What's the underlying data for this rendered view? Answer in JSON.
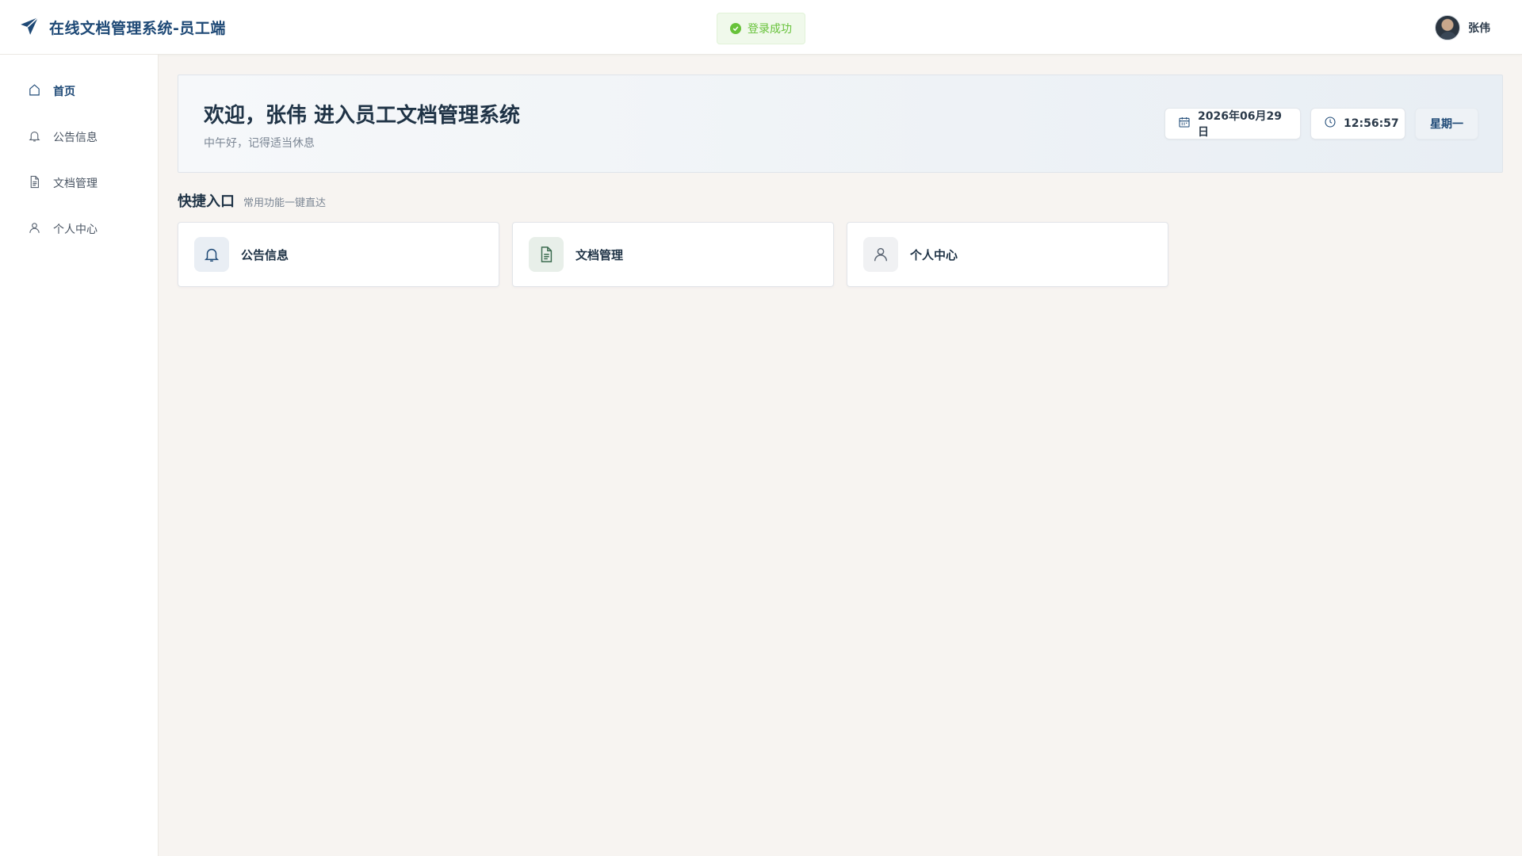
{
  "header": {
    "title": "在线文档管理系统-员工端",
    "logo_icon": "paper-plane-icon",
    "brand_color": "#1e4976",
    "user_name": "张伟"
  },
  "toast": {
    "message": "登录成功",
    "status": "success",
    "color": "#67c23a"
  },
  "sidebar": {
    "items": [
      {
        "label": "首页",
        "icon": "home-icon",
        "active": true
      },
      {
        "label": "公告信息",
        "icon": "bell-icon",
        "active": false
      },
      {
        "label": "文档管理",
        "icon": "document-icon",
        "active": false
      },
      {
        "label": "个人中心",
        "icon": "user-icon",
        "active": false
      }
    ]
  },
  "welcome": {
    "title": "欢迎，张伟 进入员工文档管理系统",
    "subtitle": "中午好，记得适当休息",
    "date": "2026年06月29日",
    "time": "12:56:57",
    "weekday": "星期一"
  },
  "quick": {
    "title": "快捷入口",
    "subtitle": "常用功能一键直达",
    "cards": [
      {
        "label": "公告信息",
        "icon": "bell-icon"
      },
      {
        "label": "文档管理",
        "icon": "document-icon"
      },
      {
        "label": "个人中心",
        "icon": "user-icon"
      }
    ]
  }
}
